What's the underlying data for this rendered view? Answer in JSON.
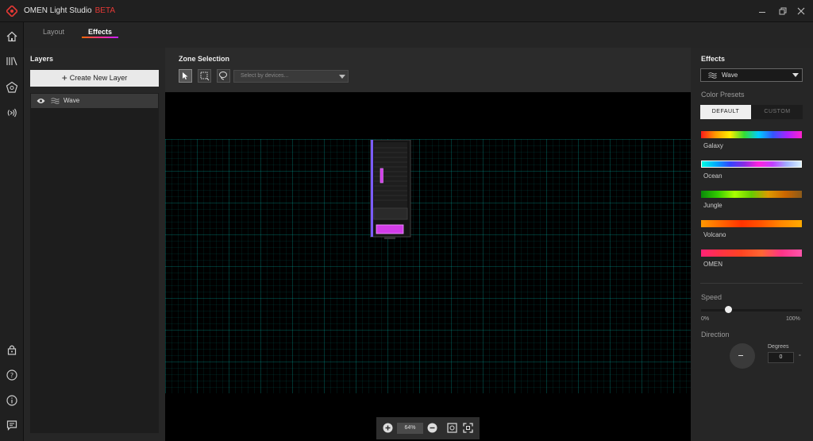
{
  "window": {
    "title": "OMEN Light Studio",
    "badge": "BETA"
  },
  "nav": {
    "icons": [
      "home-icon",
      "library-icon",
      "scenes-icon",
      "audio-icon",
      "lock-icon",
      "help-icon",
      "info-icon",
      "feedback-icon"
    ]
  },
  "tabs": [
    {
      "label": "Layout"
    },
    {
      "label": "Effects"
    }
  ],
  "layers": {
    "title": "Layers",
    "create_label": "Create New Layer",
    "items": [
      {
        "name": "Wave"
      }
    ]
  },
  "zone": {
    "title": "Zone Selection",
    "device_placeholder": "Select by devices..."
  },
  "canvas": {
    "zoom": "64%"
  },
  "effects": {
    "title": "Effects",
    "selected": "Wave",
    "color_presets_label": "Color Presets",
    "preset_tabs": {
      "default": "DEFAULT",
      "custom": "CUSTOM"
    },
    "presets": [
      {
        "name": "Galaxy"
      },
      {
        "name": "Ocean"
      },
      {
        "name": "Jungle"
      },
      {
        "name": "Volcano"
      },
      {
        "name": "OMEN"
      }
    ],
    "speed": {
      "label": "Speed",
      "min_label": "0%",
      "max_label": "100%",
      "value": 0.27
    },
    "direction": {
      "label": "Direction",
      "degrees_label": "Degrees",
      "degrees_value": "0",
      "degree_sign": "°"
    }
  },
  "colors": {
    "accent": "#e53935",
    "tab_gradient_start": "#ff6a00",
    "tab_gradient_end": "#c51fff",
    "zone_purple": "#7b5cff",
    "zone_magenta": "#d23ce8"
  }
}
